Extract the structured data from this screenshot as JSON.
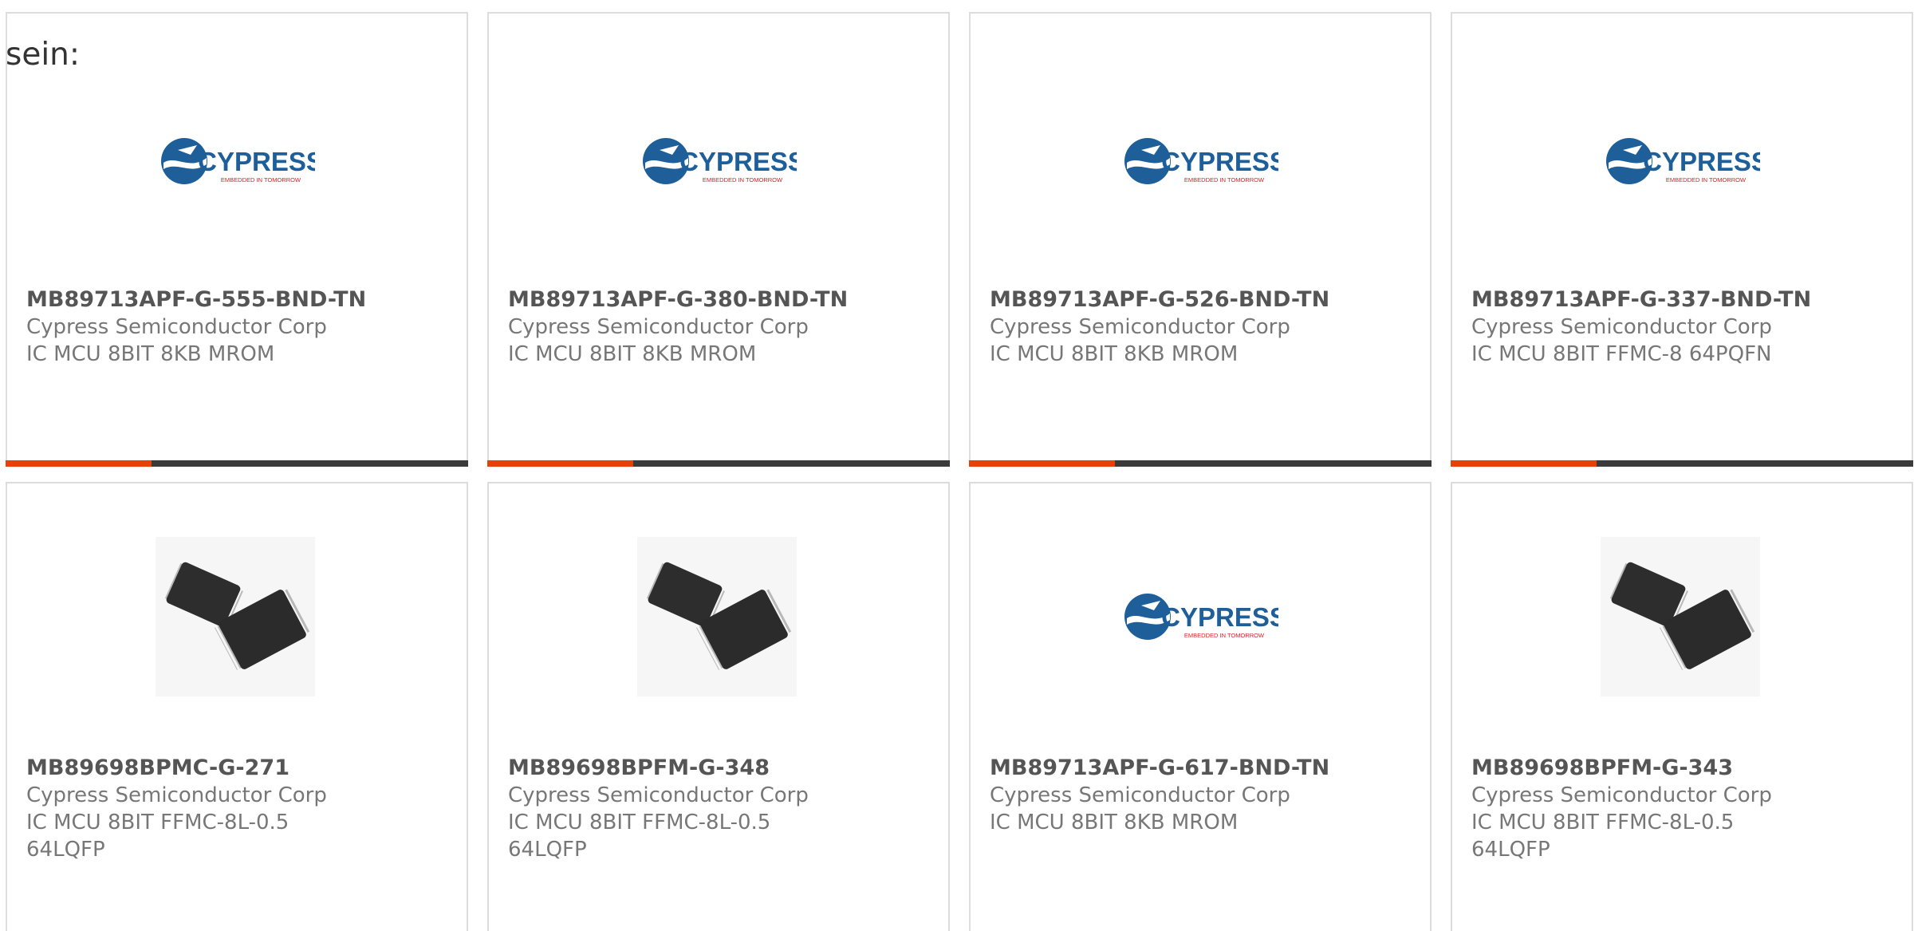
{
  "intro_text": "sein:",
  "brand_colors": {
    "accent": "#e8400c",
    "bar": "#3a3a3a",
    "logo_blue": "#1e5f9a",
    "logo_red": "#d8202a"
  },
  "logo": {
    "name": "cypress-logo",
    "wordmark": "CYPRESS",
    "tagline": "EMBEDDED IN TOMORROW"
  },
  "products": [
    {
      "part_number": "MB89713APF-G-555-BND-TN",
      "manufacturer": "Cypress Semiconductor Corp",
      "description": "IC MCU 8BIT 8KB MROM",
      "image": "cypress-logo"
    },
    {
      "part_number": "MB89713APF-G-380-BND-TN",
      "manufacturer": "Cypress Semiconductor Corp",
      "description": "IC MCU 8BIT 8KB MROM",
      "image": "cypress-logo"
    },
    {
      "part_number": "MB89713APF-G-526-BND-TN",
      "manufacturer": "Cypress Semiconductor Corp",
      "description": "IC MCU 8BIT 8KB MROM",
      "image": "cypress-logo"
    },
    {
      "part_number": "MB89713APF-G-337-BND-TN",
      "manufacturer": "Cypress Semiconductor Corp",
      "description": "IC MCU 8BIT FFMC-8 64PQFN",
      "image": "cypress-logo"
    },
    {
      "part_number": "MB89698BPMC-G-271",
      "manufacturer": "Cypress Semiconductor Corp",
      "description": "IC MCU 8BIT FFMC-8L-0.5\n64LQFP",
      "image": "qfp-chip"
    },
    {
      "part_number": "MB89698BPFM-G-348",
      "manufacturer": "Cypress Semiconductor Corp",
      "description": "IC MCU 8BIT FFMC-8L-0.5\n64LQFP",
      "image": "qfp-chip"
    },
    {
      "part_number": "MB89713APF-G-617-BND-TN",
      "manufacturer": "Cypress Semiconductor Corp",
      "description": "IC MCU 8BIT 8KB MROM",
      "image": "cypress-logo"
    },
    {
      "part_number": "MB89698BPFM-G-343",
      "manufacturer": "Cypress Semiconductor Corp",
      "description": "IC MCU 8BIT FFMC-8L-0.5\n64LQFP",
      "image": "qfp-chip"
    }
  ]
}
